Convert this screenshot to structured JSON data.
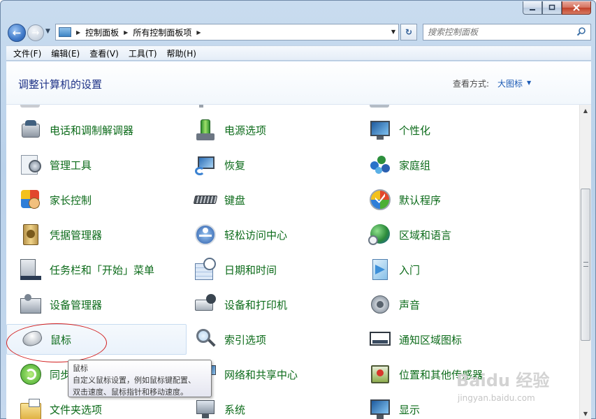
{
  "window": {
    "minimize_icon": "minimize-icon",
    "maximize_icon": "maximize-icon",
    "close_icon": "close-icon"
  },
  "nav": {
    "breadcrumbs": [
      "控制面板",
      "所有控制面板项"
    ],
    "search_placeholder": "搜索控制面板"
  },
  "menu": [
    "文件(F)",
    "编辑(E)",
    "查看(V)",
    "工具(T)",
    "帮助(H)"
  ],
  "header": {
    "title": "调整计算机的设置",
    "view_by_label": "查看方式:",
    "view_by_value": "大图标"
  },
  "items": [
    {
      "label": "电话和调制解调器",
      "icon": "phone-modem-icon"
    },
    {
      "label": "电源选项",
      "icon": "power-options-icon"
    },
    {
      "label": "个性化",
      "icon": "personalization-icon"
    },
    {
      "label": "管理工具",
      "icon": "admin-tools-icon"
    },
    {
      "label": "恢复",
      "icon": "recovery-icon"
    },
    {
      "label": "家庭组",
      "icon": "homegroup-icon"
    },
    {
      "label": "家长控制",
      "icon": "parental-controls-icon"
    },
    {
      "label": "键盘",
      "icon": "keyboard-icon"
    },
    {
      "label": "默认程序",
      "icon": "default-programs-icon"
    },
    {
      "label": "凭据管理器",
      "icon": "credential-manager-icon"
    },
    {
      "label": "轻松访问中心",
      "icon": "ease-of-access-icon"
    },
    {
      "label": "区域和语言",
      "icon": "region-language-icon"
    },
    {
      "label": "任务栏和「开始」菜单",
      "icon": "taskbar-start-menu-icon"
    },
    {
      "label": "日期和时间",
      "icon": "date-time-icon"
    },
    {
      "label": "入门",
      "icon": "getting-started-icon"
    },
    {
      "label": "设备管理器",
      "icon": "device-manager-icon"
    },
    {
      "label": "设备和打印机",
      "icon": "devices-printers-icon"
    },
    {
      "label": "声音",
      "icon": "sound-icon"
    },
    {
      "label": "鼠标",
      "icon": "mouse-icon"
    },
    {
      "label": "索引选项",
      "icon": "indexing-options-icon"
    },
    {
      "label": "通知区域图标",
      "icon": "notification-area-icon"
    },
    {
      "label": "同步中心",
      "icon": "sync-center-icon"
    },
    {
      "label": "网络和共享中心",
      "icon": "network-sharing-icon"
    },
    {
      "label": "位置和其他传感器",
      "icon": "location-sensors-icon"
    },
    {
      "label": "文件夹选项",
      "icon": "folder-options-icon"
    },
    {
      "label": "系统",
      "icon": "system-icon"
    },
    {
      "label": "显示",
      "icon": "display-icon"
    }
  ],
  "tooltip": {
    "title": "鼠标",
    "line1": "自定义鼠标设置，例如鼠标键配置、",
    "line2": "双击速度、鼠标指针和移动速度。"
  },
  "watermark": {
    "line1": "Baidu 经验",
    "line2": "jingyan.baidu.com"
  },
  "colors": {
    "item_text": "#0c6b1a",
    "header_title": "#1e3287",
    "link_blue": "#1c5bb5",
    "annotation_red": "#d21e1e"
  }
}
